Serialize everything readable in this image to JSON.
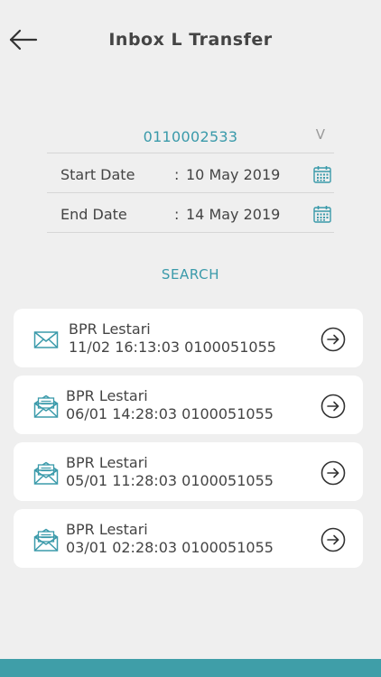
{
  "header": {
    "title": "Inbox L Transfer"
  },
  "filter": {
    "account": "0110002533",
    "dropdown_indicator": "V",
    "start_date_label": "Start Date",
    "start_date_value": "10 May 2019",
    "end_date_label": "End Date",
    "end_date_value": "14 May 2019",
    "separator": ":"
  },
  "search_label": "SEARCH",
  "messages": [
    {
      "sender": "BPR Lestari",
      "detail": "11/02 16:13:03 0100051055",
      "icon": "envelope-closed-icon"
    },
    {
      "sender": "BPR Lestari",
      "detail": "06/01 14:28:03 0100051055",
      "icon": "envelope-open-icon"
    },
    {
      "sender": "BPR Lestari",
      "detail": "05/01 11:28:03 0100051055",
      "icon": "envelope-open-icon"
    },
    {
      "sender": "BPR Lestari",
      "detail": "03/01 02:28:03 0100051055",
      "icon": "envelope-open-icon"
    }
  ],
  "colors": {
    "accent": "#3a9aaa",
    "background": "#efefef",
    "footer": "#3f9ea8"
  }
}
